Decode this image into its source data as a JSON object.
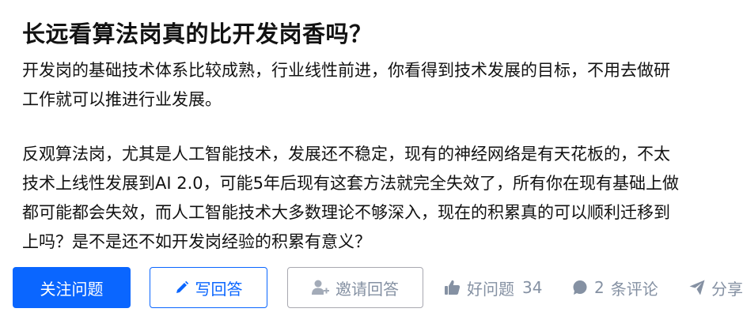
{
  "question": {
    "title": "长远看算法岗真的比开发岗香吗？",
    "paragraph1": [
      "开发岗的基础技术体系比较成熟，行业线性前进，你看得到技术发展的目标，不用去做研",
      "工作就可以推进行业发展。"
    ],
    "paragraph2": [
      "反观算法岗，尤其是人工智能技术，发展还不稳定，现有的神经网络是有天花板的，不太",
      "技术上线性发展到AI 2.0，可能5年后现有这套方法就完全失效了，所有你在现有基础上做",
      "都可能都会失效，而人工智能技术大多数理论不够深入，现在的积累真的可以顺利迁移到",
      "上吗？是不是还不如开发岗经验的积累有意义？"
    ]
  },
  "actions": {
    "follow_label": "关注问题",
    "answer_label": "写回答",
    "invite_label": "邀请回答",
    "good_question_label": "好问题",
    "good_question_count": "34",
    "comment_count": "2",
    "comment_label": "条评论",
    "share_label": "分享"
  },
  "icons": {
    "answer": "pencil-icon",
    "invite": "add-user-icon",
    "good_question": "thumbs-up-icon",
    "comment": "comment-bubble-icon",
    "share": "paper-plane-icon"
  },
  "colors": {
    "primary": "#0a66ff",
    "meta_gray": "#8591a3",
    "text": "#121212"
  }
}
